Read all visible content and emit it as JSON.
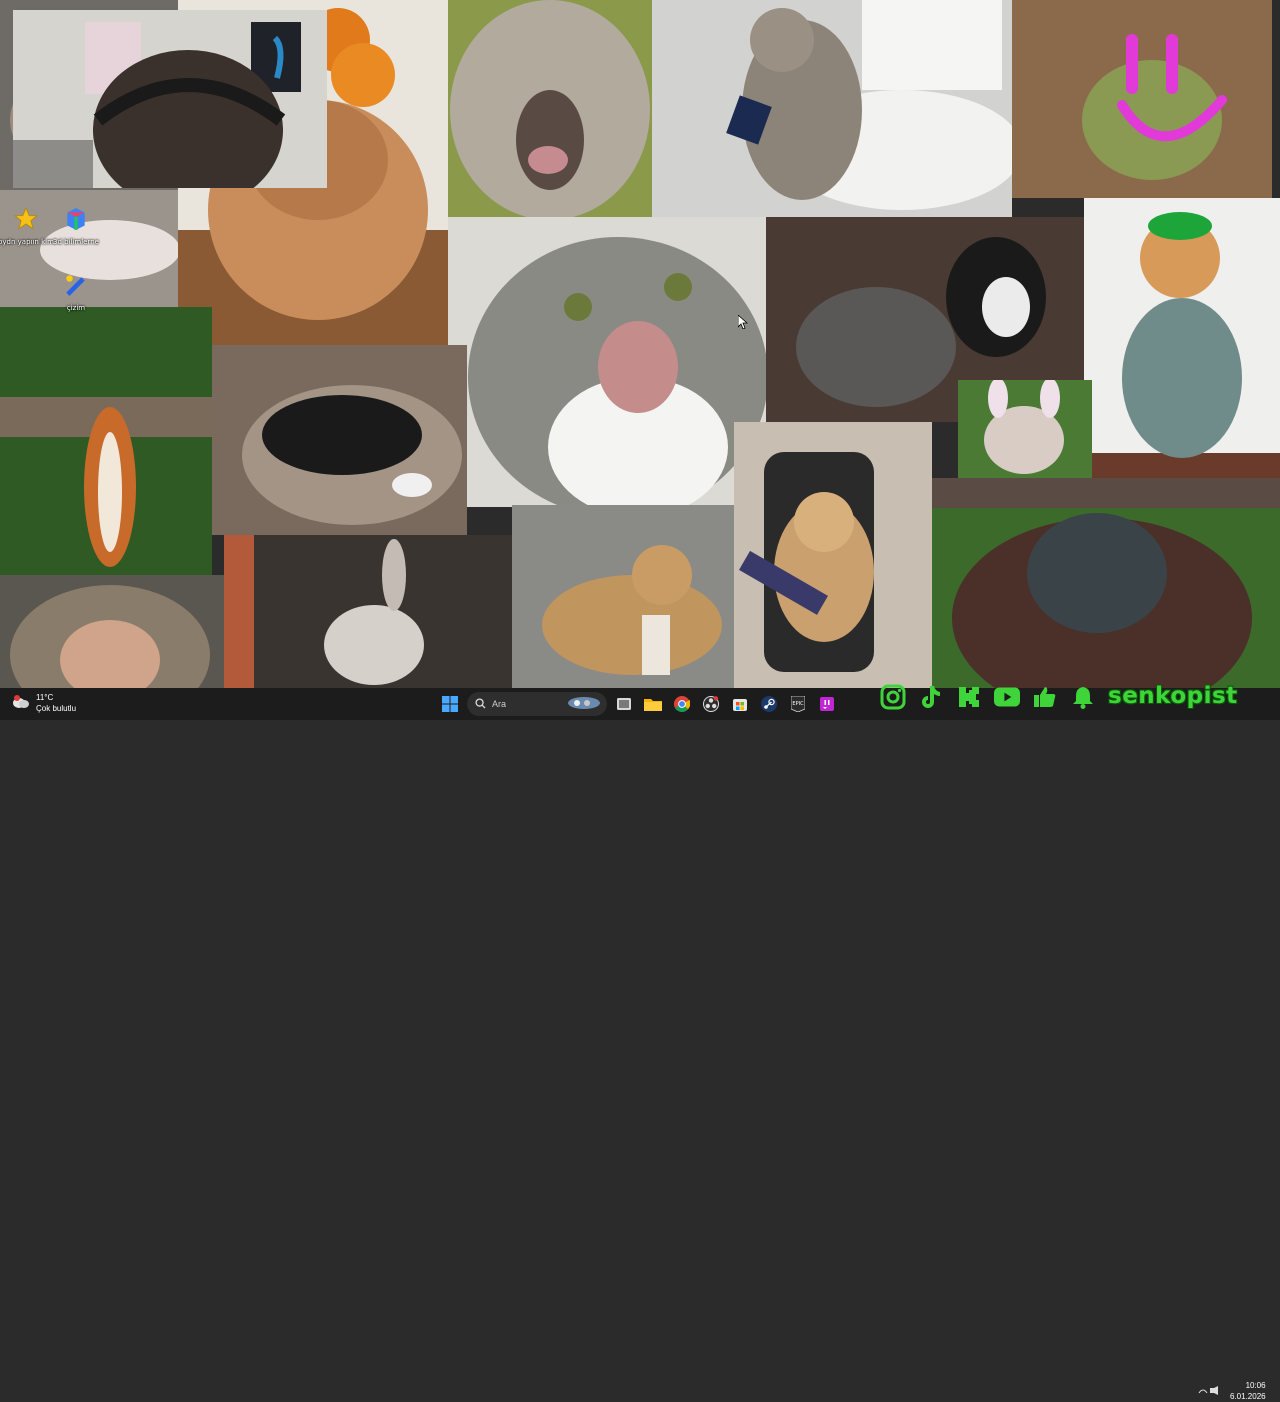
{
  "desktop": {
    "icons": [
      {
        "label": "oydn yapıın kim",
        "icon": "star-icon"
      },
      {
        "label": "3d bilimlerne",
        "icon": "paint-3d-icon"
      },
      {
        "label": "çizim",
        "icon": "drawing-icon"
      }
    ]
  },
  "taskbar": {
    "weather": {
      "temp": "11°C",
      "condition": "Çok bulutlu"
    },
    "search_placeholder": "Ara",
    "apps": [
      "windows-start-icon",
      "search-icon",
      "widgets-icon",
      "task-view-icon",
      "file-explorer-icon",
      "chrome-icon",
      "obs-icon",
      "microsoft-store-icon",
      "steam-icon",
      "epic-games-icon",
      "twitch-icon"
    ],
    "clock": {
      "time": "10:06",
      "date": "6.01.2026"
    }
  },
  "overlay": {
    "socials": [
      "instagram-icon",
      "tiktok-icon",
      "kick-icon",
      "youtube-icon",
      "like-icon",
      "bell-icon"
    ],
    "channel_name": "senkopist",
    "accent": "#3fd43a"
  }
}
